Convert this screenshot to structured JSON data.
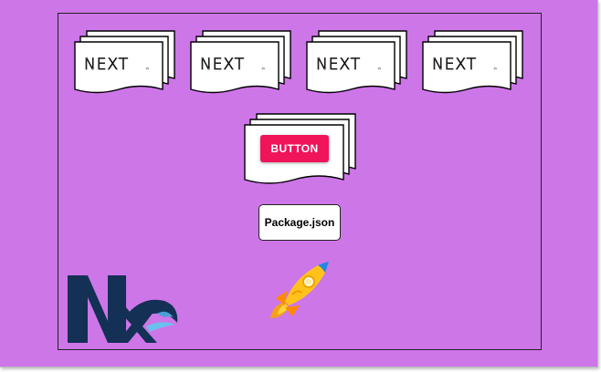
{
  "apps": [
    {
      "logo": "NEXT",
      "sub": ".js"
    },
    {
      "logo": "NEXT",
      "sub": ".js"
    },
    {
      "logo": "NEXT",
      "sub": ".js"
    },
    {
      "logo": "NEXT",
      "sub": ".js"
    }
  ],
  "ui_library": {
    "button_label": "BUTTON"
  },
  "package": {
    "label": "Package.json"
  },
  "icons": {
    "monorepo_logo": "nx-logo-icon",
    "deploy": "rocket-icon",
    "app": "nextjs-logo-icon",
    "document": "document-stack-icon"
  },
  "colors": {
    "background": "#cd76e8",
    "button": "#f0145a",
    "nx_navy": "#143055",
    "nx_accent": "#4a9fd8"
  }
}
